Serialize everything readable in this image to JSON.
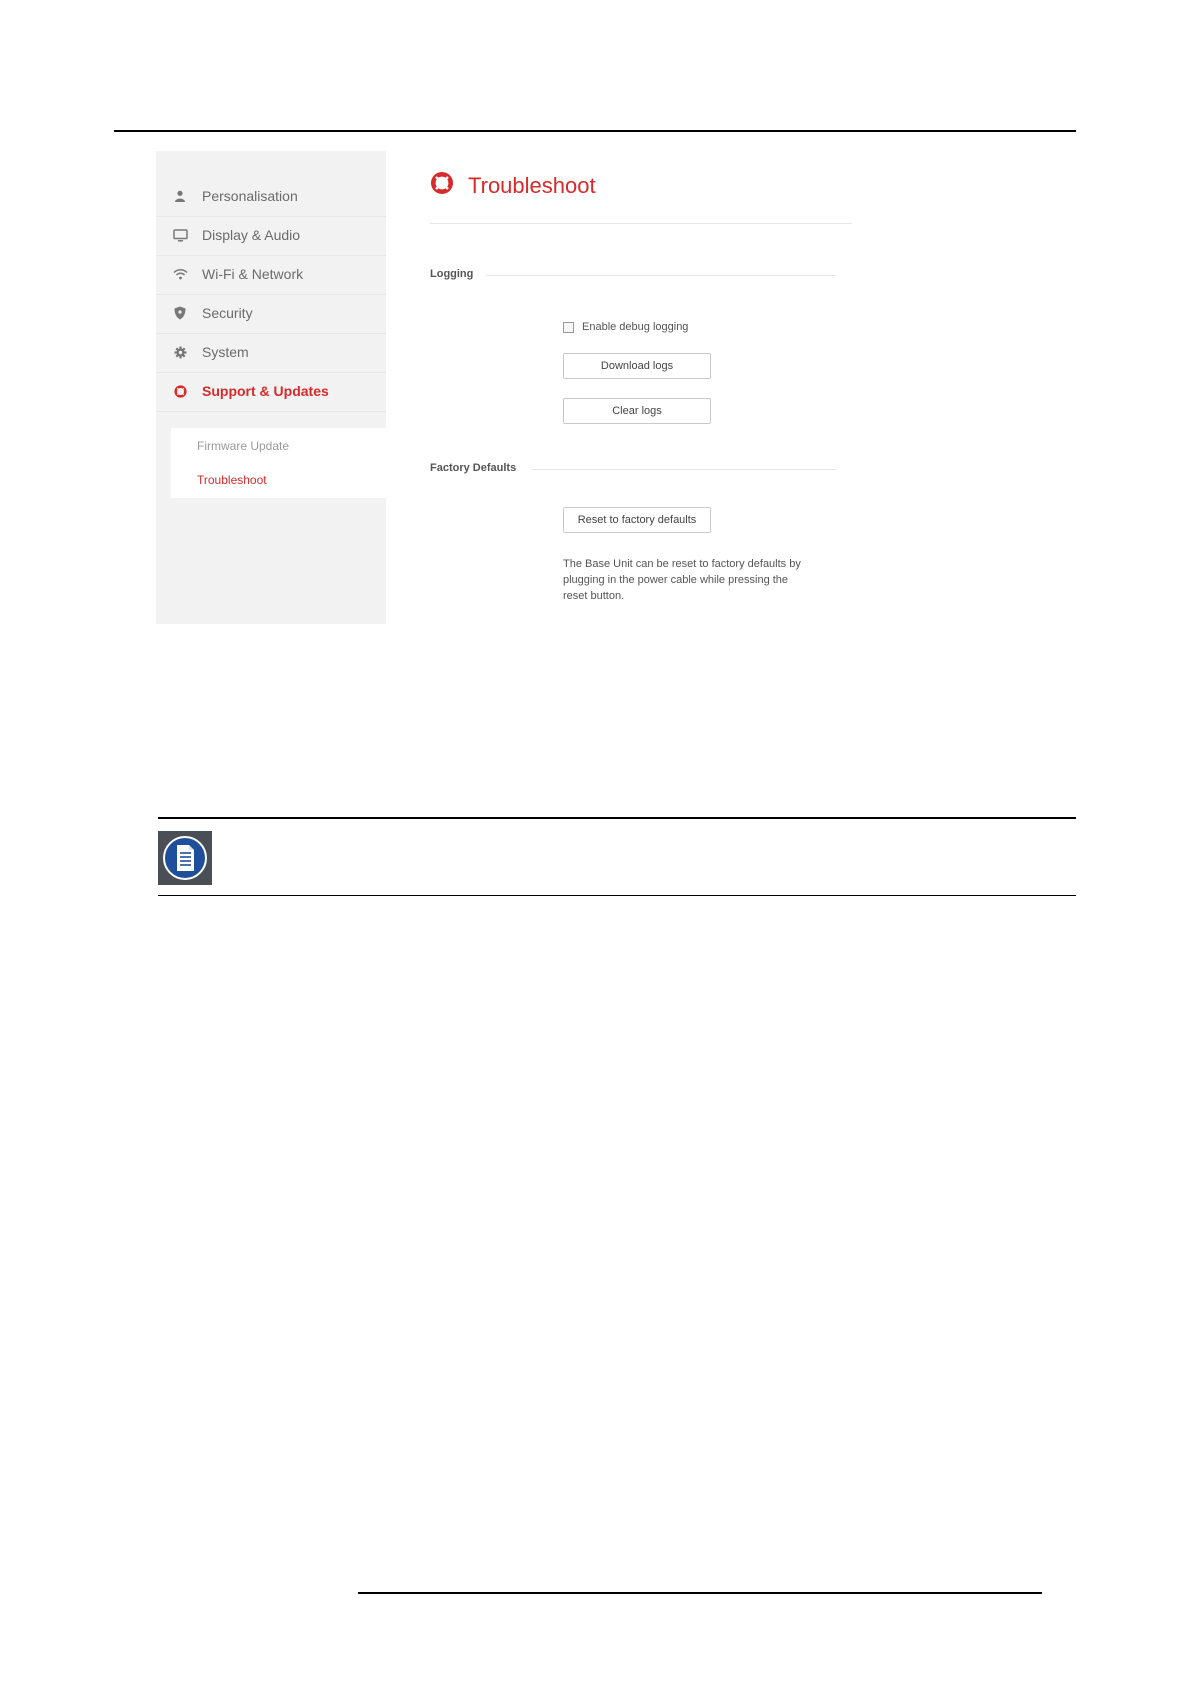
{
  "sidebar": {
    "items": [
      {
        "label": "Personalisation",
        "icon": "person-icon"
      },
      {
        "label": "Display & Audio",
        "icon": "monitor-icon"
      },
      {
        "label": "Wi-Fi & Network",
        "icon": "wifi-icon"
      },
      {
        "label": "Security",
        "icon": "shield-icon"
      },
      {
        "label": "System",
        "icon": "gear-icon"
      },
      {
        "label": "Support & Updates",
        "icon": "lifebuoy-icon",
        "active": true
      }
    ],
    "subitems": [
      {
        "label": "Firmware Update"
      },
      {
        "label": "Troubleshoot",
        "active": true
      }
    ]
  },
  "main": {
    "title": "Troubleshoot",
    "logging": {
      "label": "Logging",
      "debug_checkbox_label": "Enable debug logging",
      "debug_checked": false,
      "download_label": "Download logs",
      "clear_label": "Clear logs"
    },
    "factory": {
      "label": "Factory Defaults",
      "reset_label": "Reset to factory defaults",
      "help": "The Base Unit can be reset to factory defaults by plugging in the power cable while pressing the reset button."
    }
  },
  "colors": {
    "accent": "#d72a2a",
    "sidebar_bg": "#f2f2f2",
    "note_icon_bg": "#4a4f55",
    "note_icon_circle": "#1f4f9a"
  }
}
